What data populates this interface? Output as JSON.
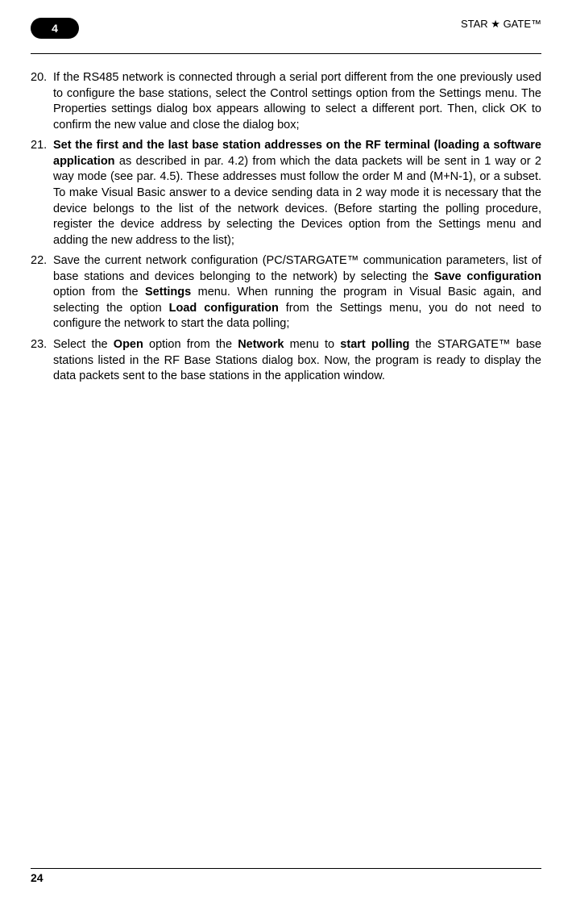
{
  "header": {
    "tab_number": "4",
    "title": "STAR ★ GATE™"
  },
  "items": [
    {
      "number": "20.",
      "text": "If the RS485 network is connected through a serial port different from the one previously used to configure the base stations, select the Control settings option from the Settings menu. The Properties settings dialog box appears allowing to select a different port. Then, click OK to confirm the new value and close the dialog box;"
    },
    {
      "number": "21.",
      "text_parts": [
        {
          "text": "Set the first and the last base station addresses on the RF terminal (loading a software application",
          "bold": true
        },
        {
          "text": " as described in par. 4.2) from which the data packets will be sent in 1 way or 2 way mode (see par. 4.5). These addresses must follow the order M and (M+N-1), or a subset. To make Visual Basic answer to a device sending data in 2 way mode it is necessary that the device belongs to the list of the network devices. (Before starting the polling procedure, register the device address by selecting the Devices option from the Settings menu and adding the new address to the list);",
          "bold": false
        }
      ]
    },
    {
      "number": "22.",
      "text_parts": [
        {
          "text": "Save the current network configuration (PC/STARGATE™ communication parameters, list of base stations and devices belonging to the network) by selecting the ",
          "bold": false
        },
        {
          "text": "Save configuration",
          "bold": true
        },
        {
          "text": " option from the ",
          "bold": false
        },
        {
          "text": "Settings",
          "bold": true
        },
        {
          "text": " menu. When running the program in Visual Basic again, and selecting the option ",
          "bold": false
        },
        {
          "text": "Load configuration",
          "bold": true
        },
        {
          "text": " from the Settings menu, you do not need to configure the network to start the data polling;",
          "bold": false
        }
      ]
    },
    {
      "number": "23.",
      "text_parts": [
        {
          "text": "Select the ",
          "bold": false
        },
        {
          "text": "Open",
          "bold": true
        },
        {
          "text": " option from the ",
          "bold": false
        },
        {
          "text": "Network",
          "bold": true
        },
        {
          "text": " menu to ",
          "bold": false
        },
        {
          "text": "start polling",
          "bold": true
        },
        {
          "text": " the STARGATE™ base stations listed in the RF Base Stations dialog box. Now, the program is ready to display the data packets sent to the base stations in the application window.",
          "bold": false
        }
      ]
    }
  ],
  "footer": {
    "page_number": "24"
  }
}
